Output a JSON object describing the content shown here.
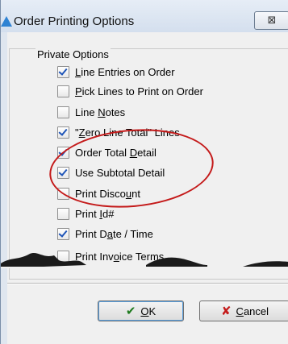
{
  "dialog": {
    "title": "Order Printing Options",
    "close_glyph": "⊠",
    "icon": "blue-triangle-app-icon"
  },
  "group": {
    "legend": "Private Options",
    "options": [
      {
        "pre": "",
        "u": "L",
        "post": "ine Entries on Order",
        "checked": true
      },
      {
        "pre": "",
        "u": "P",
        "post": "ick Lines to Print on Order",
        "checked": false
      },
      {
        "pre": "Line ",
        "u": "N",
        "post": "otes",
        "checked": false
      },
      {
        "pre": "\"",
        "u": "Z",
        "post": "ero Line Total\" Lines",
        "checked": true
      },
      {
        "pre": "Order Total ",
        "u": "D",
        "post": "etail",
        "checked": true
      },
      {
        "pre": "Use Subtotal Detail",
        "u": "",
        "post": "",
        "checked": true
      },
      {
        "pre": "Print Disco",
        "u": "u",
        "post": "nt",
        "checked": false
      },
      {
        "pre": "Print ",
        "u": "I",
        "post": "d#",
        "checked": false
      },
      {
        "pre": "Print D",
        "u": "a",
        "post": "te / Time",
        "checked": true
      },
      {
        "pre": "Print Inv",
        "u": "o",
        "post": "ice Terms",
        "checked": false
      }
    ]
  },
  "buttons": {
    "ok": {
      "u": "O",
      "post": "K",
      "glyph": "✔"
    },
    "cancel": {
      "u": "C",
      "post": "ancel",
      "glyph": "✘"
    }
  },
  "colors": {
    "annotation": "#c41a1a",
    "check": "#1f55b8",
    "title_bar": "#d4dfee"
  }
}
